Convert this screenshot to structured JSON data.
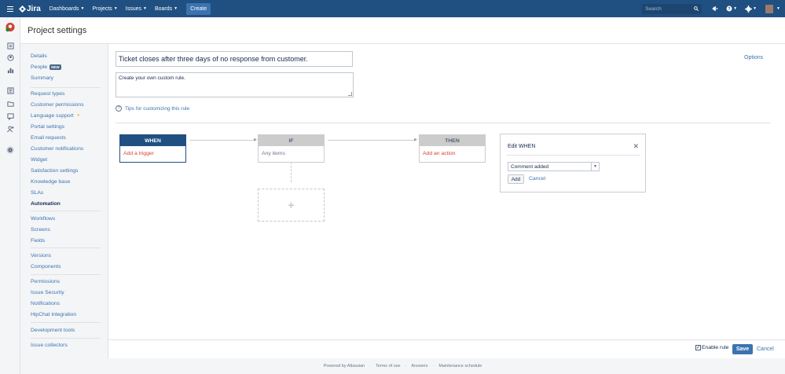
{
  "topbar": {
    "logo": "Jira",
    "nav": [
      "Dashboards",
      "Projects",
      "Issues",
      "Boards"
    ],
    "create": "Create",
    "search_placeholder": "Search"
  },
  "header": {
    "title": "Project settings"
  },
  "sidebar": {
    "group1": [
      {
        "label": "Details"
      },
      {
        "label": "People",
        "badge": "NEW"
      },
      {
        "label": "Summary"
      }
    ],
    "group2": [
      {
        "label": "Request types"
      },
      {
        "label": "Customer permissions"
      },
      {
        "label": "Language support"
      },
      {
        "label": "Portal settings"
      },
      {
        "label": "Email requests"
      },
      {
        "label": "Customer notifications"
      },
      {
        "label": "Widget"
      },
      {
        "label": "Satisfaction settings"
      },
      {
        "label": "Knowledge base"
      },
      {
        "label": "SLAs"
      },
      {
        "label": "Automation"
      }
    ],
    "group3": [
      {
        "label": "Workflows"
      },
      {
        "label": "Screens"
      },
      {
        "label": "Fields"
      }
    ],
    "group4": [
      {
        "label": "Versions"
      },
      {
        "label": "Components"
      }
    ],
    "group5": [
      {
        "label": "Permissions"
      },
      {
        "label": "Issue Security"
      },
      {
        "label": "Notifications"
      },
      {
        "label": "HipChat integration"
      }
    ],
    "group6": [
      {
        "label": "Development tools"
      }
    ],
    "group7": [
      {
        "label": "Issue collectors"
      }
    ]
  },
  "rule": {
    "name": "Ticket closes after three days of no response from customer.",
    "description": "Create your own custom rule.",
    "options": "Options",
    "tips": "Tips for customizing this rule"
  },
  "flow": {
    "when": {
      "title": "WHEN",
      "action": "Add a trigger"
    },
    "if": {
      "title": "IF",
      "action": "Any items"
    },
    "then": {
      "title": "THEN",
      "action": "Add an action"
    }
  },
  "edit_when": {
    "title": "Edit WHEN",
    "selected": "Comment added",
    "add": "Add",
    "cancel": "Cancel"
  },
  "footer_bar": {
    "enable_rule": "Enable rule",
    "enable_checked": true,
    "save": "Save",
    "cancel": "Cancel"
  },
  "page_footer": [
    "Powered by Atlassian",
    "Terms of use",
    "Answers",
    "Maintenance schedule"
  ],
  "colors": {
    "topbar": "#205081",
    "link": "#3b73af",
    "trigger_red": "#d04437"
  }
}
